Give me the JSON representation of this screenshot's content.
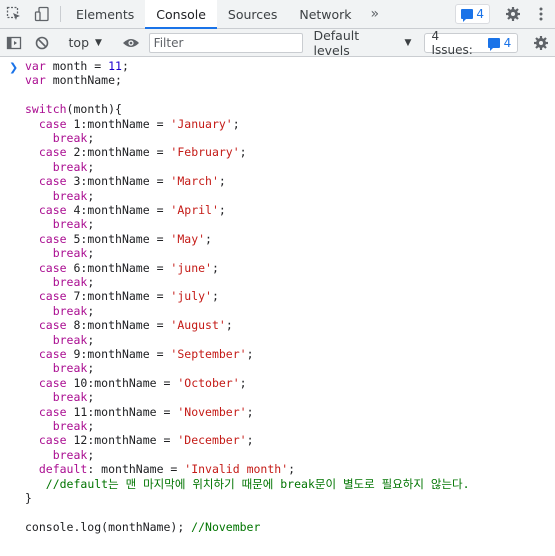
{
  "topbar": {
    "tabs": [
      "Elements",
      "Console",
      "Sources",
      "Network"
    ],
    "active_tab": "Console",
    "message_count": "4"
  },
  "toolbar": {
    "context": "top",
    "filter_placeholder": "Filter",
    "levels": "Default levels",
    "issues_label": "4 Issues:",
    "issues_count": "4"
  },
  "colors": {
    "accent": "#1a73e8",
    "keyword": "#aa0d91",
    "string": "#c41a16",
    "number": "#1c00cf",
    "comment": "#007400"
  },
  "code": {
    "lines": [
      "var month = 11;",
      "var monthName;",
      "",
      "switch(month){",
      "  case 1:monthName = 'January';",
      "    break;",
      "  case 2:monthName = 'February';",
      "    break;",
      "  case 3:monthName = 'March';",
      "    break;",
      "  case 4:monthName = 'April';",
      "    break;",
      "  case 5:monthName = 'May';",
      "    break;",
      "  case 6:monthName = 'june';",
      "    break;",
      "  case 7:monthName = 'july';",
      "    break;",
      "  case 8:monthName = 'August';",
      "    break;",
      "  case 9:monthName = 'September';",
      "    break;",
      "  case 10:monthName = 'October';",
      "    break;",
      "  case 11:monthName = 'November';",
      "    break;",
      "  case 12:monthName = 'December';",
      "    break;",
      "  default: monthName = 'Invalid month';",
      "   //default는 맨 마지막에 위치하기 때문에 break문이 별도로 필요하지 않는다.",
      "}",
      "",
      "console.log(monthName); //November"
    ]
  }
}
